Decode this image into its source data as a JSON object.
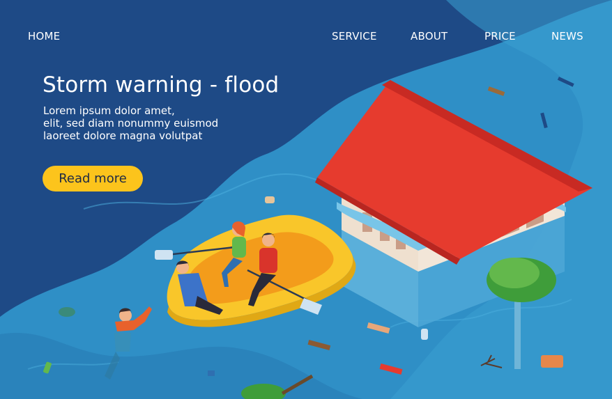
{
  "nav": {
    "items": [
      {
        "label": "HOME"
      },
      {
        "label": "SERVICE"
      },
      {
        "label": "ABOUT"
      },
      {
        "label": "PRICE"
      },
      {
        "label": "NEWS"
      }
    ]
  },
  "hero": {
    "title": "Storm warning - flood",
    "lines": [
      "Lorem ipsum dolor amet,",
      "elit, sed diam nonummy euismod",
      "laoreet dolore magna volutpat"
    ],
    "cta_label": "Read more"
  },
  "colors": {
    "deep_blue": "#1e4a86",
    "water": "#2f8fc6",
    "water_light": "#3ea6d6",
    "roof_red": "#e63b2e",
    "boat_yellow": "#f9c62a",
    "button_yellow": "#fcc41c"
  }
}
